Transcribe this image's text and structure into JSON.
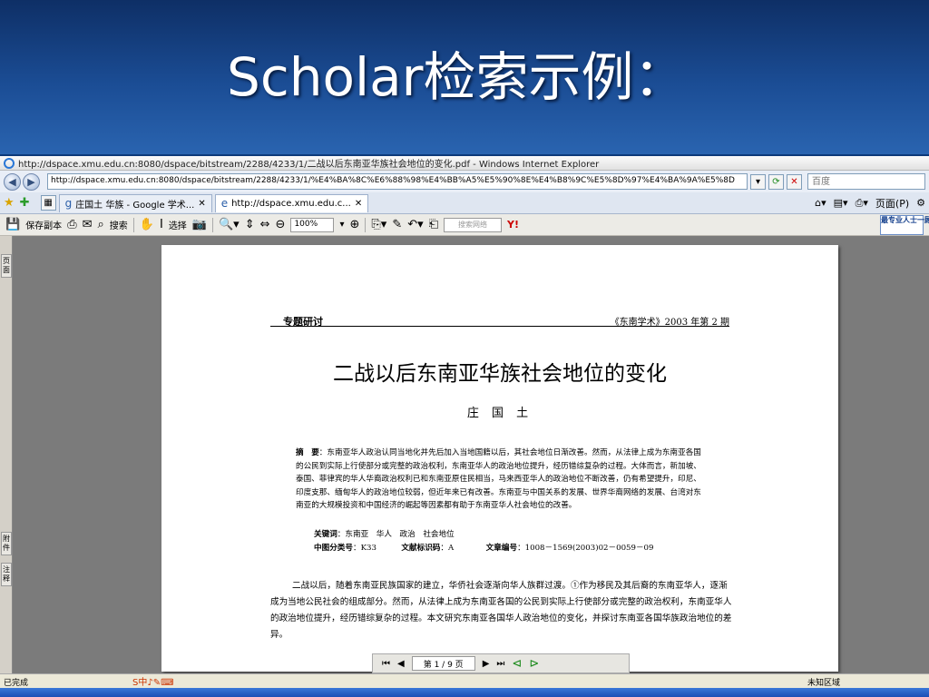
{
  "slide": {
    "title": "Scholar检索示例："
  },
  "browser": {
    "window_title": "http://dspace.xmu.edu.cn:8080/dspace/bitstream/2288/4233/1/二战以后东南亚华族社会地位的变化.pdf - Windows Internet Explorer",
    "address": "http://dspace.xmu.edu.cn:8080/dspace/bitstream/2288/4233/1/%E4%BA%8C%E6%88%98%E4%BB%A5%E5%90%8E%E4%B8%9C%E5%8D%97%E4%BA%9A%E5%8D",
    "search_placeholder": "百度",
    "tabs": [
      "庄国土 华族 - Google 学术...",
      "http://dspace.xmu.edu.c..."
    ],
    "page_menu": "页面(P)"
  },
  "pdf_toolbar": {
    "save_copy": "保存副本",
    "search": "搜索",
    "select": "选择",
    "zoom": "100%",
    "find_placeholder": "搜索网络",
    "ad_text": "最专业人士一顾片"
  },
  "sidebar": {
    "tab_pages": "页面",
    "tab_attachments": "附件",
    "tab_comments": "注释"
  },
  "document": {
    "section": "专题研讨",
    "journal": "《东南学术》2003 年第 2 期",
    "title": "二战以后东南亚华族社会地位的变化",
    "author": "庄 国 土",
    "abstract_label": "摘　要",
    "abstract": "：东南亚华人政治认同当地化并先后加入当地国籍以后，其社会地位日渐改善。然而，从法律上成为东南亚各国的公民到实际上行使部分或完整的政治权利，东南亚华人的政治地位提升，经历错综复杂的过程。大体而言，新加坡、泰国、菲律宾的华人华裔政治权利已和东南亚原住民相当，马来西亚华人的政治地位不断改善，仍有希望提升，印尼、印度支那、缅甸华人的政治地位较弱，但近年来已有改善。东南亚与中国关系的发展、世界华裔网络的发展、台湾对东南亚的大规模投资和中国经济的崛起等因素都有助于东南亚华人社会地位的改善。",
    "keywords_label": "关键词",
    "keywords": "：东南亚　华人　政治　社会地位",
    "clc_label": "中图分类号",
    "clc": "：K33",
    "doc_code_label": "文献标识码",
    "doc_code": "：A",
    "article_no_label": "文章编号",
    "article_no": "：1008－1569(2003)02－0059－09",
    "body": "二战以后，随着东南亚民族国家的建立，华侨社会逐渐向华人族群过渡。①作为移民及其后裔的东南亚华人，逐渐成为当地公民社会的组成部分。然而，从法律上成为东南亚各国的公民到实际上行使部分或完整的政治权利，东南亚华人的政治地位提升，经历错综复杂的过程。本文研究东南亚各国华人政治地位的变化，并探讨东南亚各国华族政治地位的差异。"
  },
  "page_nav": {
    "page_indicator": "第 1 / 9 页"
  },
  "status": {
    "left": "已完成",
    "zone": "未知区域"
  }
}
